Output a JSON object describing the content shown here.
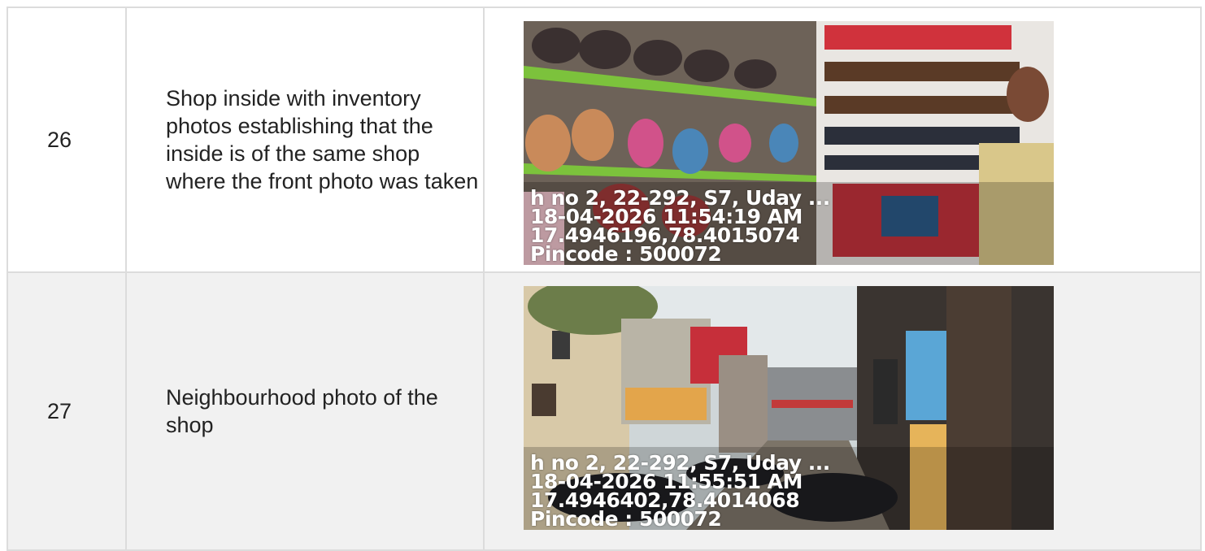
{
  "rows": [
    {
      "number": "26",
      "description": "Shop inside with inventory photos establishing that the inside is of the same shop where the front photo was taken",
      "photo": {
        "subject": "shop-interior",
        "stamp_lines": [
          "h no 2, 22-292, S7, Uday ...",
          "18-04-2026 11:54:19 AM",
          "17.4946196,78.4015074",
          "Pincode : 500072"
        ]
      }
    },
    {
      "number": "27",
      "description": "Neighbourhood photo of the shop",
      "photo": {
        "subject": "street-neighbourhood",
        "stamp_lines": [
          "h no 2, 22-292, S7, Uday ...",
          "18-04-2026 11:55:51 AM",
          "17.4946402,78.4014068",
          "Pincode : 500072"
        ]
      }
    }
  ]
}
